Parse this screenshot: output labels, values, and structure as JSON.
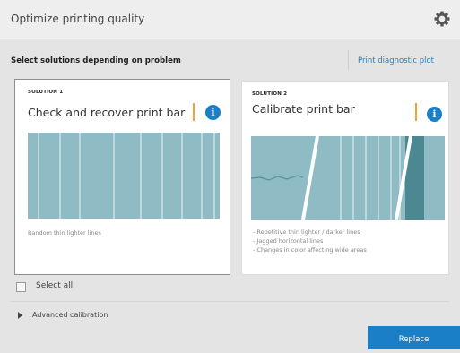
{
  "header": {
    "title": "Optimize printing quality",
    "settings_icon": "gear-icon"
  },
  "section": {
    "label": "Select solutions depending on problem",
    "diagnostic_link": "Print diagnostic plot"
  },
  "solutions": [
    {
      "label": "SOLUTION 1",
      "title": "Check and recover print bar",
      "info_icon": "info-icon",
      "description": [
        "Random thin lighter lines"
      ]
    },
    {
      "label": "SOLUTION 2",
      "title": "Calibrate print bar",
      "info_icon": "info-icon",
      "description": [
        "- Repetitive thin lighter / darker lines",
        "- Jagged horizontal lines",
        "- Changes in color affecting wide areas"
      ]
    }
  ],
  "select_all": {
    "label": "Select all",
    "checked": false
  },
  "advanced": {
    "label": "Advanced calibration"
  },
  "replace_button": {
    "label": "Replace"
  },
  "colors": {
    "accent": "#1b7fc8",
    "selection_bar": "#f2a030",
    "illustration": "#8fbcc4"
  }
}
